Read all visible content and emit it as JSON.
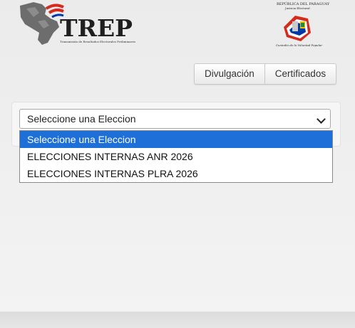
{
  "header": {
    "trep_logo_text": "TREP",
    "trep_logo_subtitle": "Transmisión de Resultados Electorales Preliminares",
    "tsje_line1": "REPÚBLICA DEL PARAGUAY",
    "tsje_line2": "Justicia Electoral",
    "tsje_line3": "Custodio de la Voluntad Popular"
  },
  "nav": {
    "divulgacion": "Divulgación",
    "certificados": "Certificados"
  },
  "election_select": {
    "selected": "Seleccione una Eleccion",
    "options": [
      "Seleccione una Eleccion",
      "ELECCIONES INTERNAS ANR 2026",
      "ELECCIONES INTERNAS PLRA 2026"
    ]
  },
  "colors": {
    "selected_option_bg": "#1f6fd9",
    "flag_red": "#d52b1e",
    "flag_blue": "#0038a8",
    "map_gray": "#6d6d6d"
  }
}
